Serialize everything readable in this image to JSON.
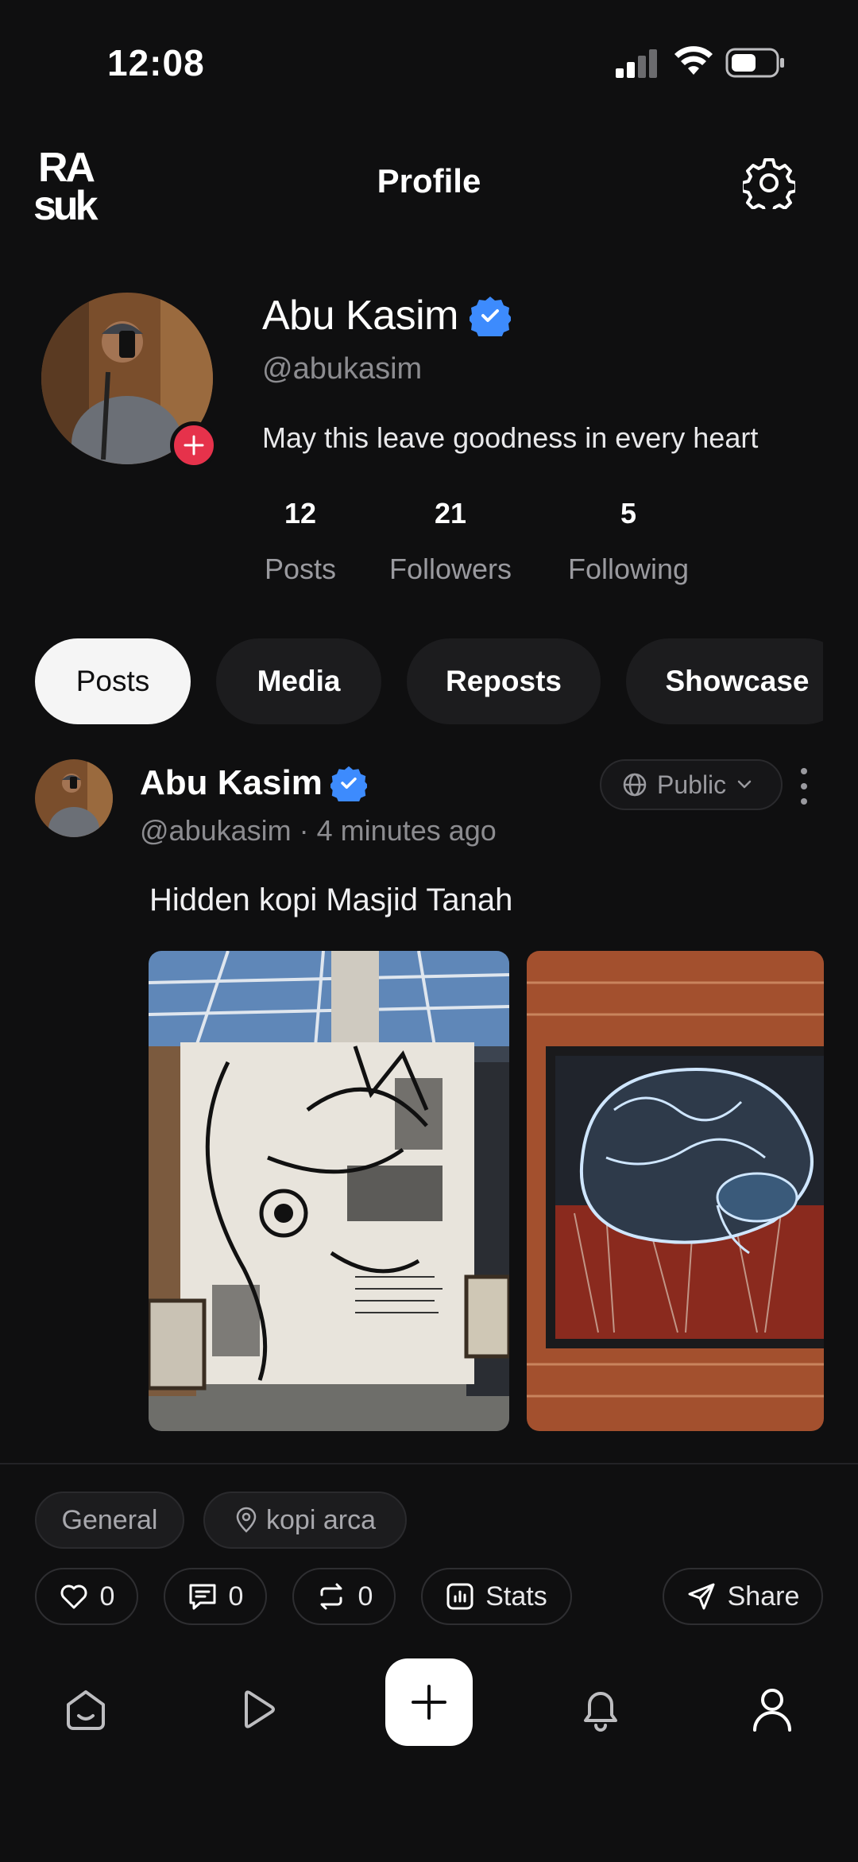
{
  "status_bar": {
    "time": "12:08"
  },
  "header": {
    "title": "Profile",
    "logo_icon": "rasuk-logo"
  },
  "profile": {
    "name": "Abu Kasim",
    "handle": "@abukasim",
    "bio": "May this leave goodness in every heart",
    "stats": [
      {
        "value": "12",
        "label": "Posts"
      },
      {
        "value": "21",
        "label": "Followers"
      },
      {
        "value": "5",
        "label": "Following"
      }
    ]
  },
  "tabs": [
    {
      "label": "Posts",
      "active": true
    },
    {
      "label": "Media",
      "active": false
    },
    {
      "label": "Reposts",
      "active": false
    },
    {
      "label": "Showcase",
      "active": false
    }
  ],
  "post": {
    "author": "Abu Kasim",
    "handle": "@abukasim",
    "time_sep": "·",
    "time": "4 minutes ago",
    "visibility": "Public",
    "text": "Hidden kopi Masjid Tanah",
    "category": "General",
    "location": "kopi arca",
    "likes": "0",
    "comments": "0",
    "reposts": "0",
    "stats_label": "Stats",
    "share_label": "Share"
  },
  "colors": {
    "background": "#0f0f10",
    "verified": "#3d8bfd",
    "add_badge": "#e6324b",
    "muted_text": "#8c8c90"
  }
}
